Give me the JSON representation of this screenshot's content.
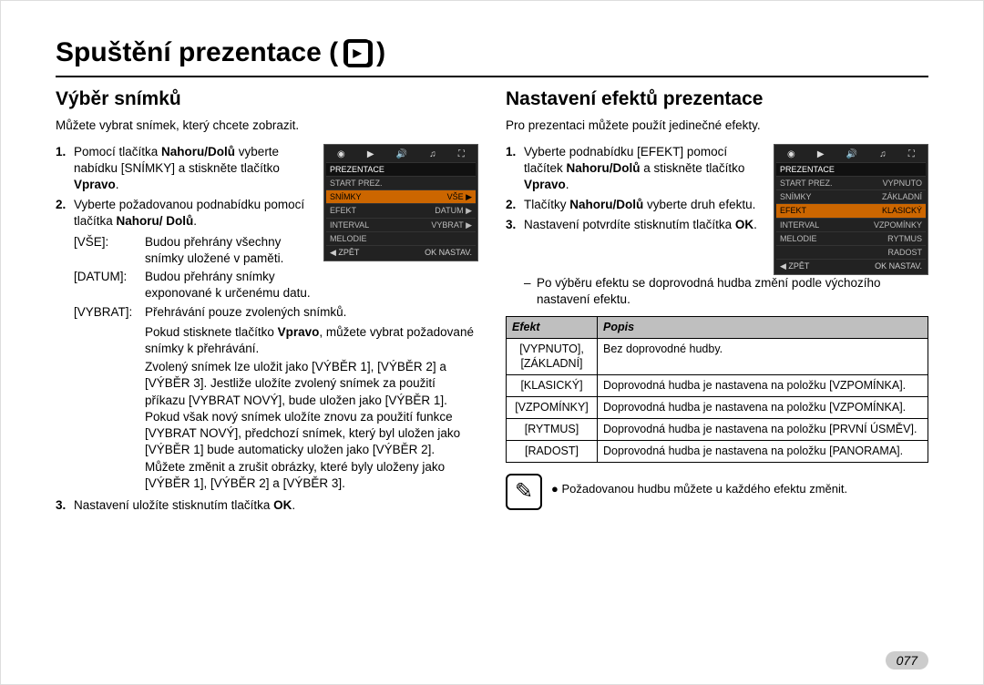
{
  "page_title": "Spuštění prezentace (",
  "page_title_end": ")",
  "page_number": "077",
  "left": {
    "heading": "Výběr snímků",
    "intro": "Můžete vybrat snímek, který chcete zobrazit.",
    "step1_pre": "Pomocí tlačítka ",
    "step1_b1": "Nahoru/Dolů",
    "step1_mid": " vyberte nabídku [SNÍMKY] a stiskněte tlačítko ",
    "step1_b2": "Vpravo",
    "step1_end": ".",
    "step2_pre": "Vyberte požadovanou podnabídku pomocí tlačítka ",
    "step2_b1": "Nahoru/ Dolů",
    "step2_end": ".",
    "opt_vse_l": "[VŠE]:",
    "opt_vse_d": "Budou přehrány všechny snímky uložené v paměti.",
    "opt_datum_l": "[DATUM]:",
    "opt_datum_d": "Budou přehrány snímky exponované k určenému datu.",
    "opt_vybrat_l": "[VYBRAT]:",
    "opt_vybrat_d": "Přehrávání pouze zvolených snímků.",
    "vybrat_extra1": "Pokud stisknete tlačítko ",
    "vybrat_extra1_b": "Vpravo",
    "vybrat_extra1_end": ", můžete vybrat požadované snímky k přehrávání.",
    "vybrat_extra2": "Zvolený snímek lze uložit jako [VÝBĚR 1], [VÝBĚR 2] a [VÝBĚR 3]. Jestliže uložíte zvolený snímek za použití příkazu [VYBRAT NOVÝ], bude uložen jako [VÝBĚR 1]. Pokud však nový snímek uložíte znovu za použití funkce [VYBRAT NOVÝ], předchozí snímek, který byl uložen jako [VÝBĚR 1] bude automaticky uložen jako [VÝBĚR 2]. Můžete změnit a zrušit obrázky, které byly uloženy jako [VÝBĚR 1], [VÝBĚR 2] a [VÝBĚR 3].",
    "step3_pre": "Nastavení uložíte stisknutím tlačítka ",
    "step3_b": "OK",
    "step3_end": ".",
    "lcd": {
      "head": "PREZENTACE",
      "rows": [
        [
          "START PREZ.",
          ""
        ],
        [
          "SNÍMKY",
          "VŠE ▶"
        ],
        [
          "EFEKT",
          "DATUM ▶"
        ],
        [
          "INTERVAL",
          "VYBRAT ▶"
        ],
        [
          "MELODIE",
          ""
        ]
      ],
      "bottom_l": "◀ ZPĚT",
      "bottom_r": "OK NASTAV."
    }
  },
  "right": {
    "heading": "Nastavení efektů prezentace",
    "intro": "Pro prezentaci můžete použít jedinečné efekty.",
    "step1_pre": "Vyberte podnabídku [EFEKT] pomocí tlačítek ",
    "step1_b1": "Nahoru/Dolů",
    "step1_mid": " a stiskněte tlačítko ",
    "step1_b2": "Vpravo",
    "step1_end": ".",
    "step2_pre": "Tlačítky ",
    "step2_b1": "Nahoru/Dolů",
    "step2_end": " vyberte druh efektu.",
    "step3_pre": "Nastavení potvrdíte stisknutím tlačítka ",
    "step3_b": "OK",
    "step3_end": ".",
    "dash_text": "Po výběru efektu se doprovodná hudba změní podle výchozího nastavení efektu.",
    "table": {
      "th1": "Efekt",
      "th2": "Popis",
      "rows": [
        {
          "e": "[VYPNUTO], [ZÁKLADNÍ]",
          "p": "Bez doprovodné hudby."
        },
        {
          "e": "[KLASICKÝ]",
          "p": "Doprovodná hudba je nastavena na položku [VZPOMÍNKA]."
        },
        {
          "e": "[VZPOMÍNKY]",
          "p": "Doprovodná hudba je nastavena na položku [VZPOMÍNKA]."
        },
        {
          "e": "[RYTMUS]",
          "p": "Doprovodná hudba je nastavena na položku [PRVNÍ ÚSMĚV]."
        },
        {
          "e": "[RADOST]",
          "p": "Doprovodná hudba je nastavena na položku [PANORAMA]."
        }
      ]
    },
    "note": "Požadovanou hudbu můžete u každého efektu změnit.",
    "lcd": {
      "head": "PREZENTACE",
      "rows": [
        [
          "START PREZ.",
          "VYPNUTO"
        ],
        [
          "SNÍMKY",
          "ZÁKLADNÍ"
        ],
        [
          "EFEKT",
          "KLASICKÝ"
        ],
        [
          "INTERVAL",
          "VZPOMÍNKY"
        ],
        [
          "MELODIE",
          "RYTMUS"
        ],
        [
          "",
          "RADOST"
        ]
      ],
      "bottom_l": "◀ ZPĚT",
      "bottom_r": "OK NASTAV."
    }
  }
}
